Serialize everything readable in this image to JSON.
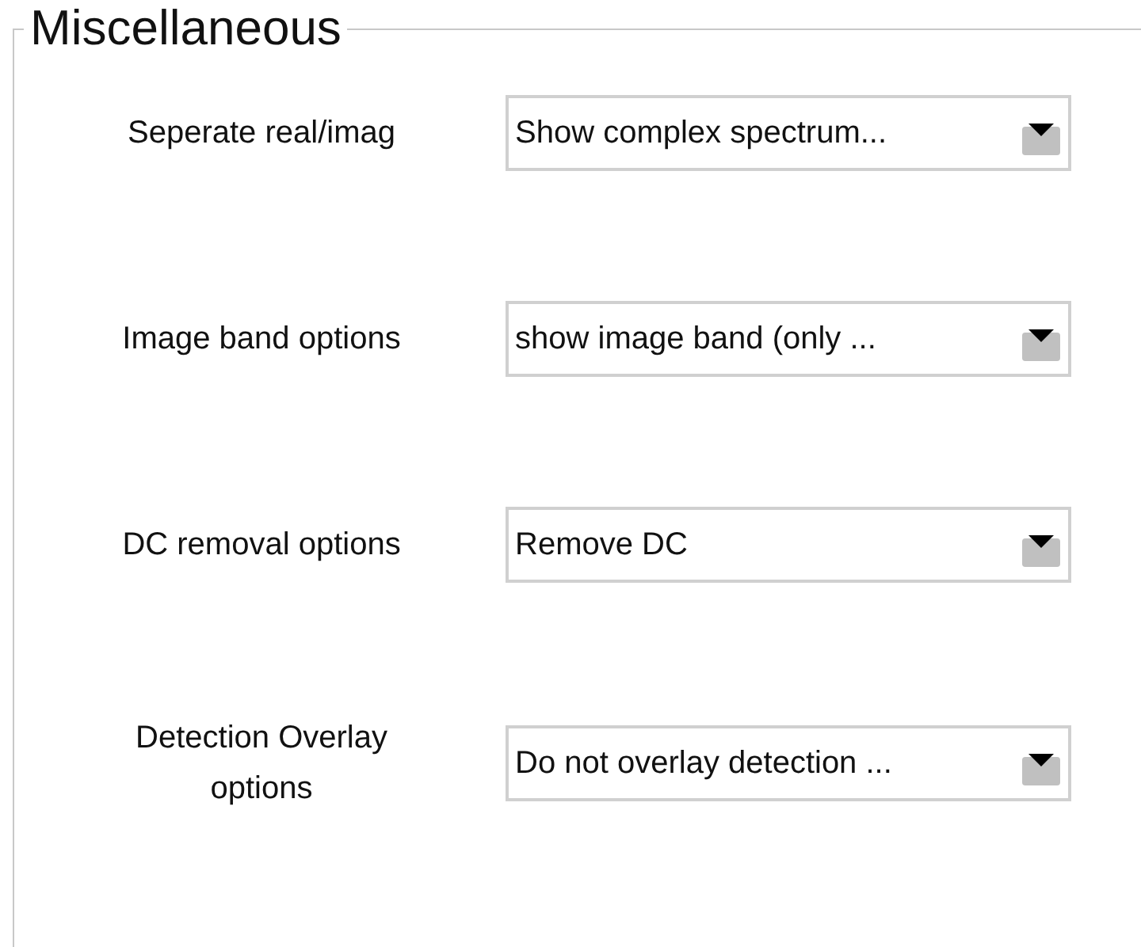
{
  "group": {
    "title": "Miscellaneous"
  },
  "rows": [
    {
      "label": "Seperate real/imag",
      "value": "Show complex spectrum..."
    },
    {
      "label": "Image band options",
      "value": "show image band (only ..."
    },
    {
      "label": "DC removal options",
      "value": "Remove DC"
    },
    {
      "label": "Detection Overlay options",
      "value": "Do not overlay detection ..."
    }
  ]
}
